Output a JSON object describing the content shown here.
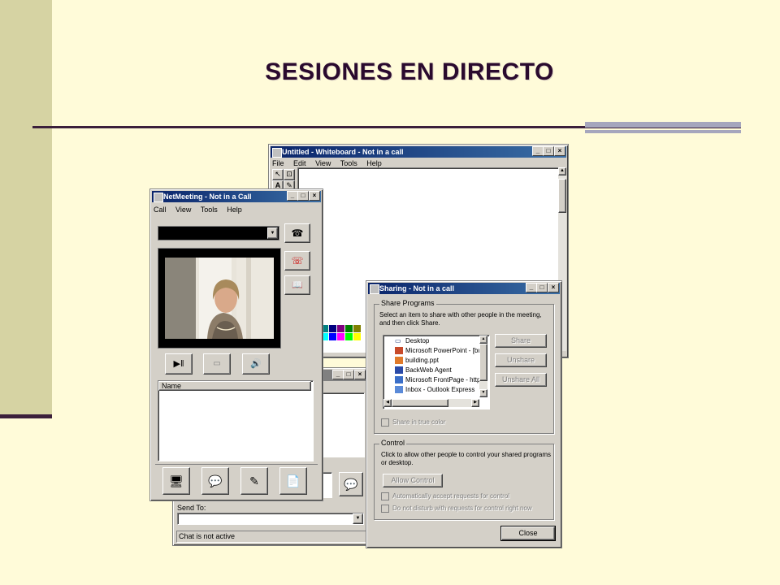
{
  "slide": {
    "title": "SESIONES EN DIRECTO"
  },
  "whiteboard": {
    "title": "Untitled - Whiteboard - Not in a call",
    "menu": [
      "File",
      "Edit",
      "View",
      "Tools",
      "Help"
    ]
  },
  "chat": {
    "send_to_label": "Send To:",
    "status": "Chat is not active"
  },
  "netmeeting": {
    "title": "NetMeeting - Not in a Call",
    "menu": [
      "Call",
      "View",
      "Tools",
      "Help"
    ],
    "name_header": "Name"
  },
  "sharing": {
    "title": "Sharing - Not in a call",
    "share_programs_label": "Share Programs",
    "share_instructions": "Select an item to share with other people in the meeting, and then click Share.",
    "programs": [
      "Desktop",
      "Microsoft PowerPoint - [buil",
      "building.ppt",
      "BackWeb Agent",
      "Microsoft FrontPage - http:/",
      "Inbox - Outlook Express"
    ],
    "share_button": "Share",
    "unshare_button": "Unshare",
    "unshare_all_button": "Unshare All",
    "true_color_label": "Share in true color",
    "control_label": "Control",
    "control_instructions": "Click to allow other people to control your shared programs or desktop.",
    "allow_control_button": "Allow Control",
    "auto_accept_label": "Automatically accept requests for control",
    "dnd_label": "Do not disturb with requests for control right now",
    "close_button": "Close"
  },
  "colors": {
    "accent_dark": "#3b1f3b",
    "titlebar": "#0a246a"
  }
}
